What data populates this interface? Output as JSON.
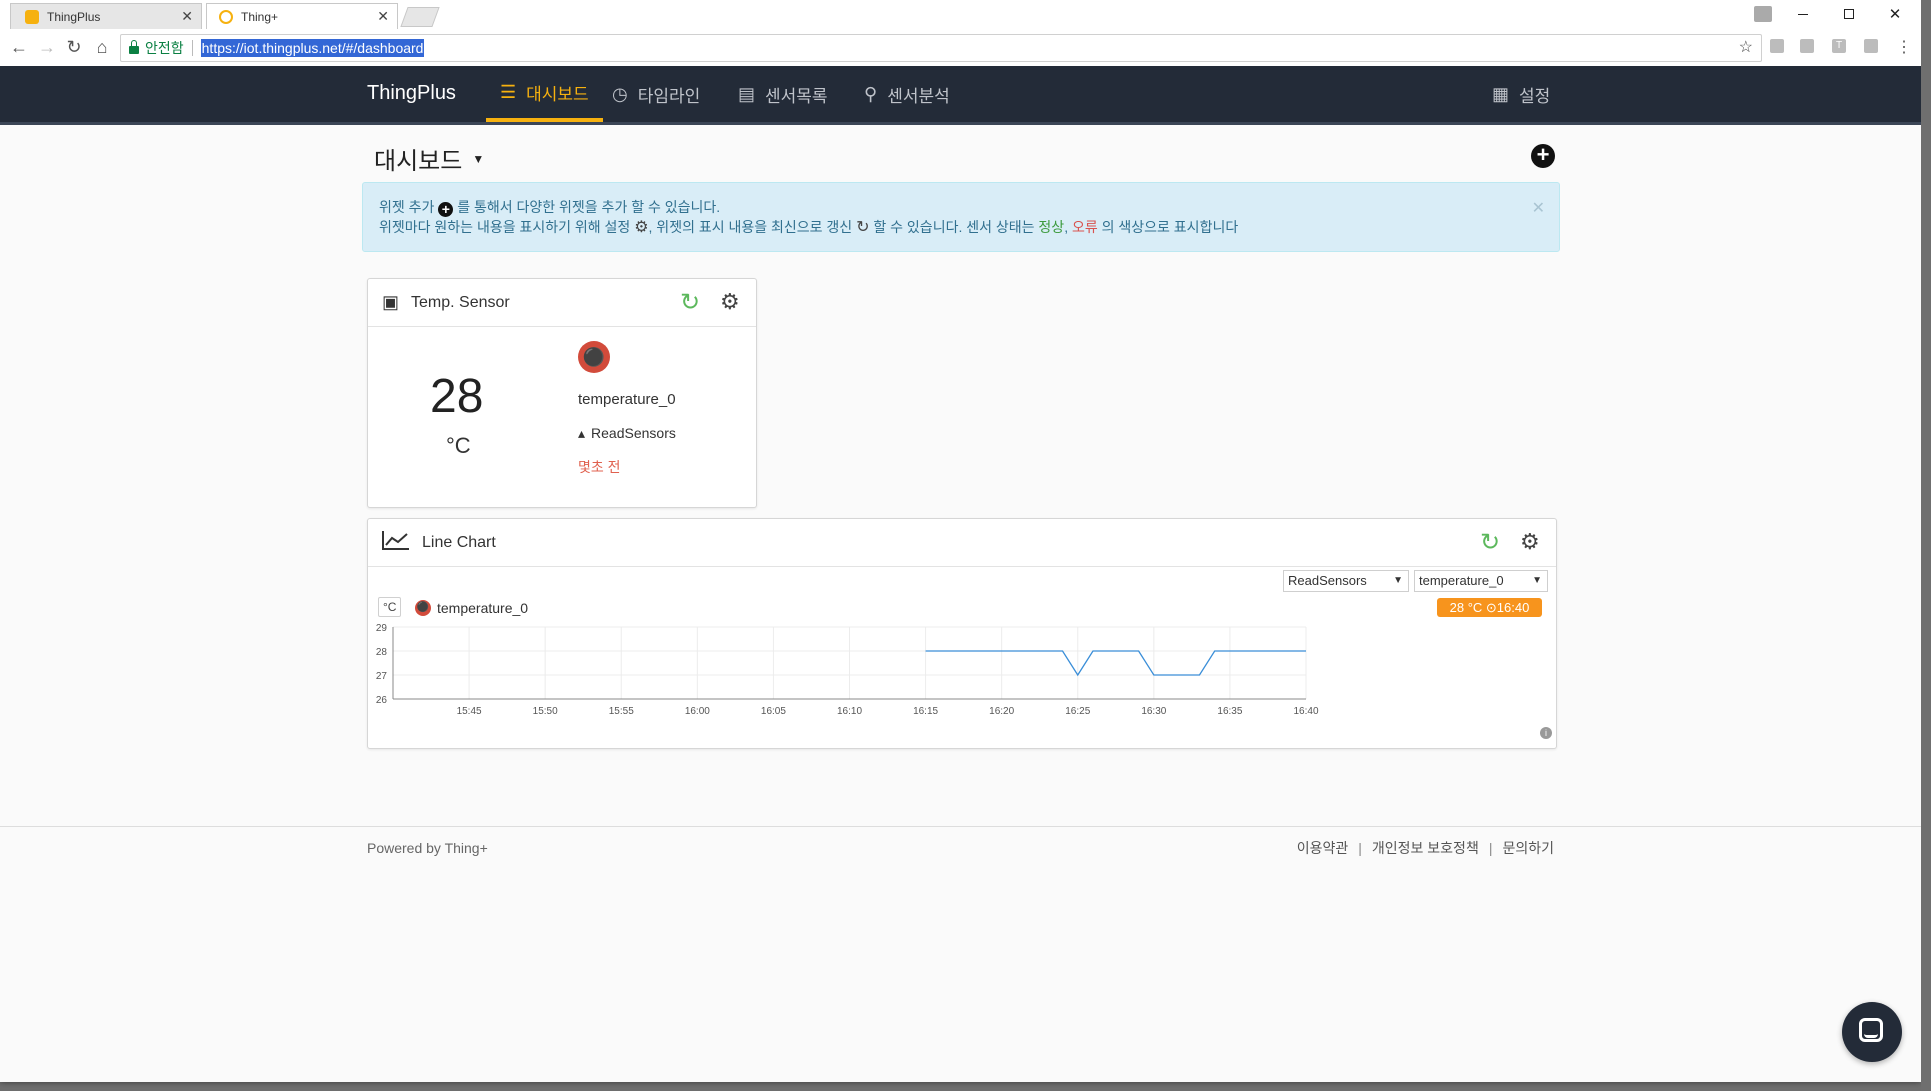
{
  "browser": {
    "tabs": [
      {
        "title": "ThingPlus",
        "active": false
      },
      {
        "title": "Thing+",
        "active": true
      }
    ],
    "close_glyph": "✕",
    "secure_label": "안전함",
    "url": "https://iot.thingplus.net/#/dashboard",
    "ext_labels": [
      "T"
    ]
  },
  "nav": {
    "brand": "ThingPlus",
    "items": [
      {
        "label": "대시보드",
        "icon": "dashboard-icon",
        "active": true
      },
      {
        "label": "타임라인",
        "icon": "clock-icon",
        "active": false
      },
      {
        "label": "센서목록",
        "icon": "chip-icon",
        "active": false
      },
      {
        "label": "센서분석",
        "icon": "analysis-icon",
        "active": false
      }
    ],
    "settings_label": "설정"
  },
  "page": {
    "title": "대시보드",
    "alert": {
      "line1_a": "위젯 추가",
      "line1_b": "를 통해서 다양한 위젯을 추가 할 수 있습니다.",
      "line2_a": "위젯마다 원하는 내용을 표시하기 위해 설정",
      "line2_b": ", 위젯의 표시 내용을 최신으로 갱신",
      "line2_c": "할 수 있습니다. 센서 상태는",
      "status_ok": "정상",
      "comma": ",",
      "status_err": "오류",
      "line2_d": "의 색상으로 표시합니다"
    }
  },
  "temp_widget": {
    "title": "Temp. Sensor",
    "value": "28",
    "unit": "°C",
    "sensor_name": "temperature_0",
    "gateway": "ReadSensors",
    "updated": "몇초 전"
  },
  "chart_widget": {
    "title": "Line Chart",
    "select_gateway": "ReadSensors",
    "select_sensor": "temperature_0",
    "unit_box": "°C",
    "legend": "temperature_0",
    "badge": "28 °C ⊙16:40"
  },
  "chart_data": {
    "type": "line",
    "title": "",
    "xlabel": "",
    "ylabel": "°C",
    "ylim": [
      26,
      29
    ],
    "y_ticks": [
      "29",
      "28",
      "27",
      "26"
    ],
    "x_ticks": [
      "15:45",
      "15:50",
      "15:55",
      "16:00",
      "16:05",
      "16:10",
      "16:15",
      "16:20",
      "16:25",
      "16:30",
      "16:35",
      "16:40"
    ],
    "grid": true,
    "series": [
      {
        "name": "temperature_0",
        "color": "#3a8ed8",
        "x": [
          "16:15",
          "16:24",
          "16:25",
          "16:26",
          "16:29",
          "16:30",
          "16:33",
          "16:34",
          "16:40"
        ],
        "y": [
          28,
          28,
          27,
          28,
          28,
          27,
          27,
          28,
          28
        ]
      }
    ]
  },
  "footer": {
    "powered": "Powered by Thing+",
    "links": [
      "이용약관",
      "개인정보 보호정책",
      "문의하기"
    ],
    "divider": "|"
  },
  "colors": {
    "accent": "#f6b10f",
    "navbar": "#232b38",
    "ok": "#3c9a3c",
    "error": "#d9534f",
    "badge": "#f7941d"
  }
}
